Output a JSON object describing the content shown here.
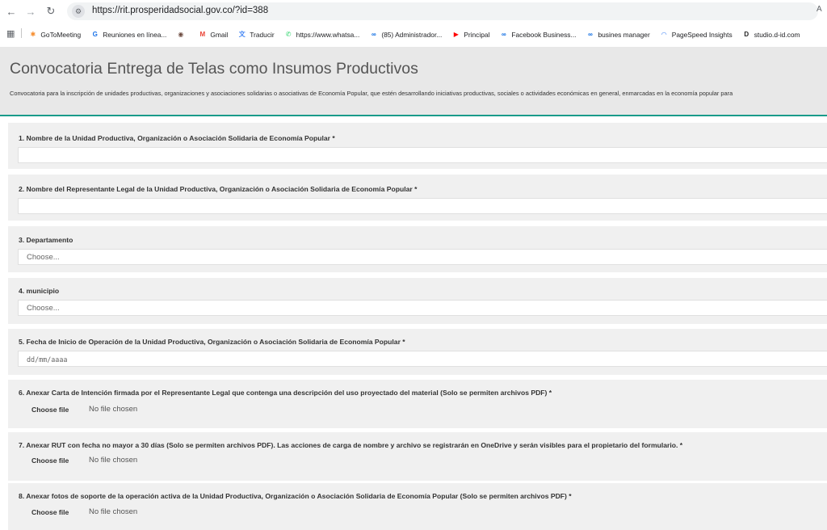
{
  "browser": {
    "url": "https://rit.prosperidadsocial.gov.co/?id=388",
    "translate": "A"
  },
  "bookmarks": [
    {
      "label": "GoToMeeting",
      "icon": "gotomeeting-icon",
      "color": "#f68d2e",
      "glyph": "✱"
    },
    {
      "label": "Reuniones en línea...",
      "icon": "g-icon",
      "color": "#1a73e8",
      "glyph": "G"
    },
    {
      "label": "",
      "icon": "globe-icon",
      "color": "#6d4c41",
      "glyph": "◉"
    },
    {
      "label": "Gmail",
      "icon": "gmail-icon",
      "color": "#ea4335",
      "glyph": "M"
    },
    {
      "label": "Traducir",
      "icon": "translate-icon",
      "color": "#4285f4",
      "glyph": "文"
    },
    {
      "label": "https://www.whatsa...",
      "icon": "whatsapp-icon",
      "color": "#25d366",
      "glyph": "✆"
    },
    {
      "label": "(85) Administrador...",
      "icon": "meta-icon",
      "color": "#0668e1",
      "glyph": "∞"
    },
    {
      "label": "Principal",
      "icon": "youtube-icon",
      "color": "#ff0000",
      "glyph": "▶"
    },
    {
      "label": "Facebook Business...",
      "icon": "meta-icon",
      "color": "#0668e1",
      "glyph": "∞"
    },
    {
      "label": "busines manager",
      "icon": "meta-icon",
      "color": "#0668e1",
      "glyph": "∞"
    },
    {
      "label": "PageSpeed Insights",
      "icon": "pagespeed-icon",
      "color": "#4285f4",
      "glyph": "◠"
    },
    {
      "label": "studio.d-id.com",
      "icon": "did-icon",
      "color": "#222222",
      "glyph": "D"
    }
  ],
  "header": {
    "title": "Convocatoria Entrega de Telas como Insumos Productivos",
    "description": "Convocatoria para la inscripción de unidades productivas, organizaciones y asociaciones solidarias o asociativas de Economía Popular, que estén desarrollando iniciativas productivas, sociales o actividades económicas en general, enmarcadas en la economía popular para"
  },
  "questions": [
    {
      "label": "1. Nombre de la Unidad Productiva, Organización o Asociación Solidaria de Economía Popular *",
      "type": "text",
      "value": ""
    },
    {
      "label": "2. Nombre del Representante Legal de la Unidad Productiva, Organización o Asociación Solidaria de Economía Popular *",
      "type": "text",
      "value": ""
    },
    {
      "label": "3. Departamento",
      "type": "select",
      "value": "Choose..."
    },
    {
      "label": "4. municipio",
      "type": "select",
      "value": "Choose..."
    },
    {
      "label": "5. Fecha de Inicio de Operación de la Unidad Productiva, Organización o Asociación Solidaria de Economía Popular *",
      "type": "date",
      "value": "dd/mm/aaaa"
    },
    {
      "label": "6. Anexar Carta de Intención firmada por el Representante Legal que contenga una descripción del uso proyectado del material (Solo se permiten archivos PDF) *",
      "type": "file",
      "button": "Choose file",
      "status": "No file chosen"
    },
    {
      "label": "7. Anexar RUT con fecha no mayor a 30 días (Solo se permiten archivos PDF). Las acciones de carga de nombre y archivo se registrarán en OneDrive y serán visibles para el propietario del formulario. *",
      "type": "file",
      "button": "Choose file",
      "status": "No file chosen"
    },
    {
      "label": "8. Anexar fotos de soporte de la operación activa de la Unidad Productiva, Organización o Asociación Solidaria de Economía Popular (Solo se permiten archivos PDF) *",
      "type": "file",
      "button": "Choose file",
      "status": "No file chosen"
    }
  ]
}
